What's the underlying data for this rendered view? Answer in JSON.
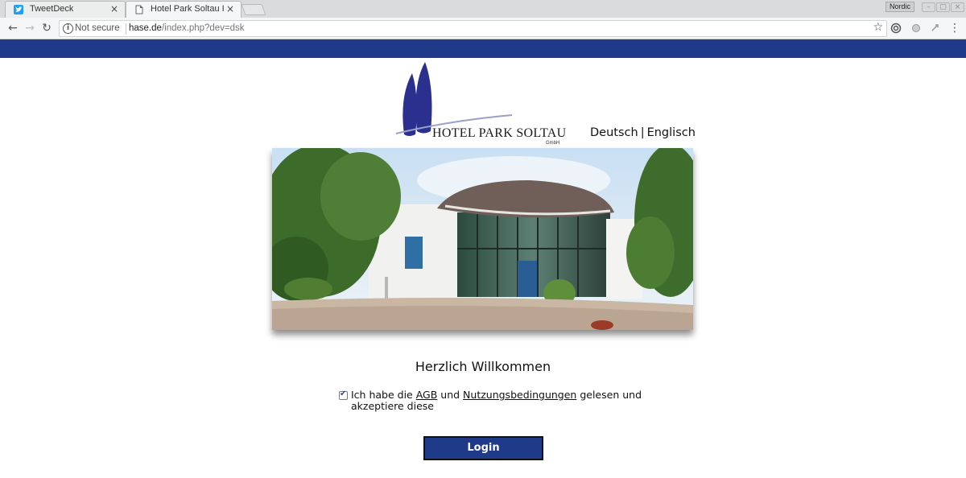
{
  "browser": {
    "tabs": [
      {
        "title": "TweetDeck",
        "close": "×",
        "favicon": "tweetdeck-bird-icon",
        "active": false
      },
      {
        "title": "Hotel Park Soltau INTE",
        "close": "×",
        "favicon": "page-icon",
        "active": true
      }
    ],
    "profile_name": "Nordic",
    "address": {
      "security_label": "Not secure",
      "host": "hase.de",
      "path": "/index.php?dev=dsk"
    }
  },
  "page": {
    "band_color": "#1e3a88",
    "logo": {
      "name": "HOTEL PARK SOLTAU",
      "suffix": "GmbH"
    },
    "language": {
      "de": "Deutsch",
      "separator": "|",
      "en": "Englisch"
    },
    "photo_alt": "hotel-building-photo",
    "welcome": "Herzlich Willkommen",
    "consent": {
      "checked": true,
      "prefix": "Ich habe die ",
      "agb": "AGB",
      "middle": " und ",
      "terms": "Nutzungsbedingungen",
      "suffix": " gelesen und akzeptiere diese"
    },
    "login_button": "Login"
  }
}
